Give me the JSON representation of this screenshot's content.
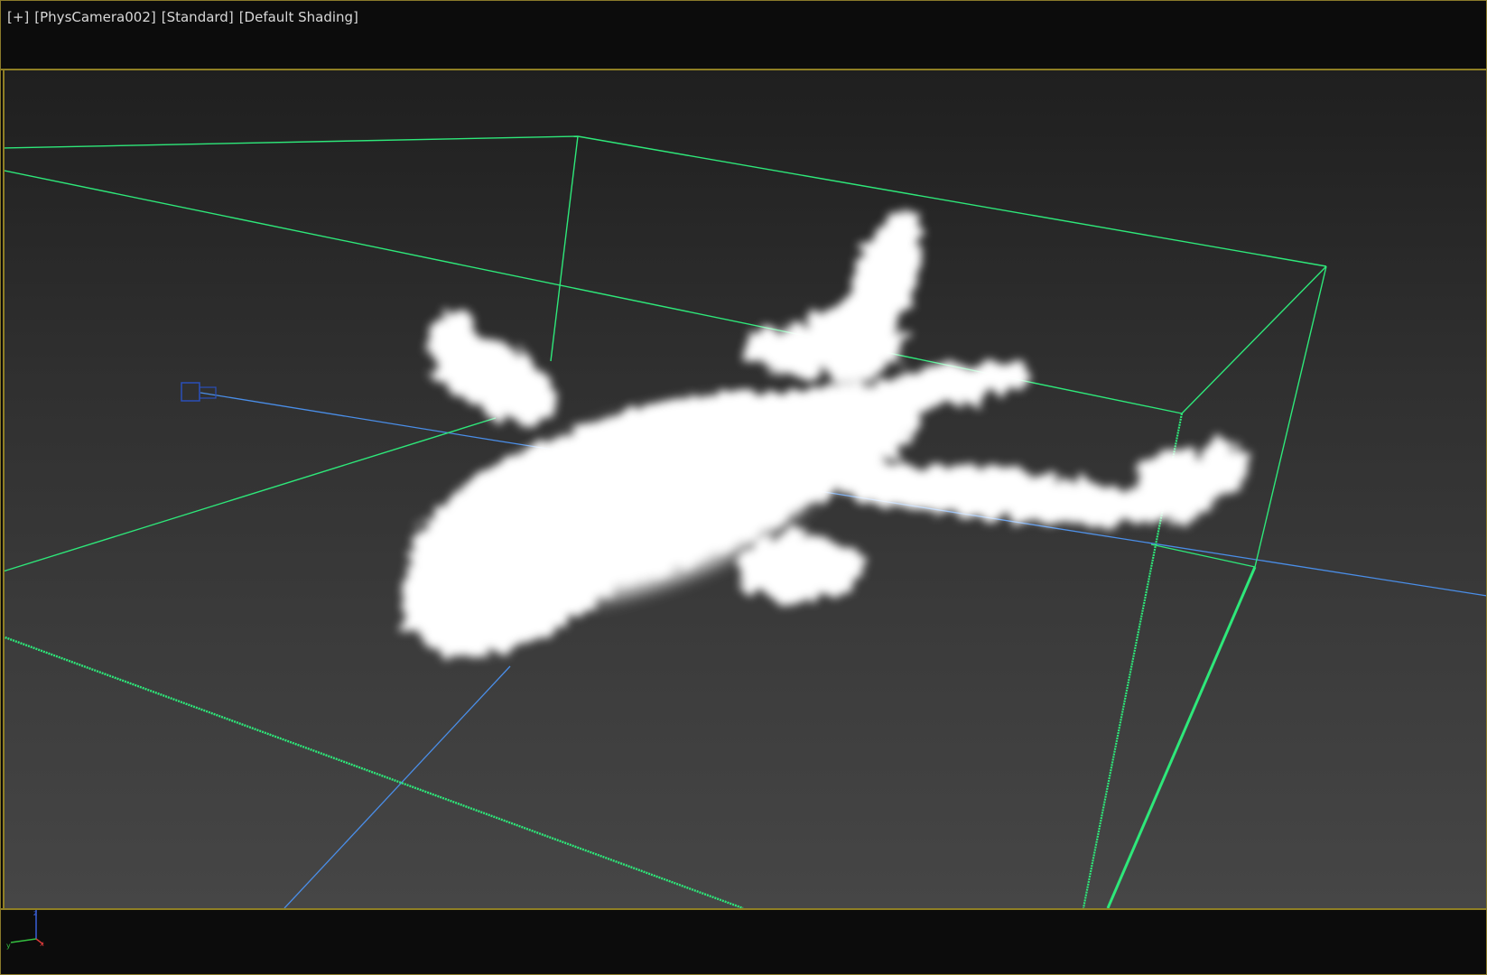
{
  "viewport": {
    "label_plus": "[+]",
    "label_camera": "[PhysCamera002]",
    "label_renderer": "[Standard]",
    "label_shading": "[Default Shading]"
  },
  "colors": {
    "viewport_border": "#8f7f24",
    "bounding_box": "#2ee87a",
    "camera_lines": "#4a8ee8",
    "cloud": "#ffffff",
    "background_top": "#1f1f1f",
    "background_bottom": "#464646"
  },
  "icons": {
    "axis_gizmo": "axis-tripod-icon",
    "camera": "camera-icon"
  }
}
